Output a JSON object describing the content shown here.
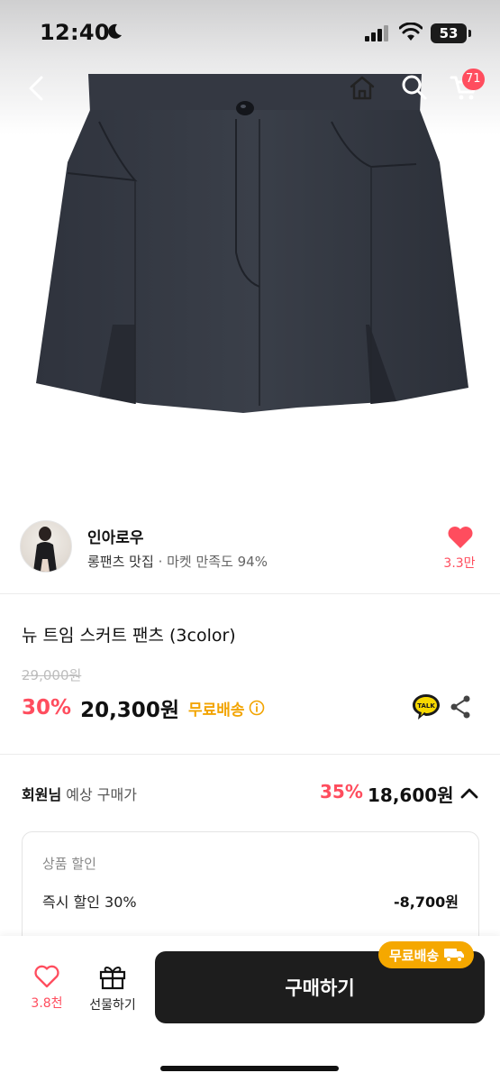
{
  "status_bar": {
    "time": "12:40",
    "battery": "53"
  },
  "nav": {
    "cart_count": "71"
  },
  "seller": {
    "name": "인아로우",
    "tagline": "롱팬츠 맛집",
    "satisfaction": "· 마켓 만족도 94%",
    "like_count": "3.3만"
  },
  "product": {
    "title": "뉴 트임 스커트 팬츠 (3color)",
    "original_price": "29,000원",
    "discount": "30%",
    "price": "20,300원",
    "shipping": "무료배송"
  },
  "member": {
    "label_strong": "회원님",
    "label_rest": " 예상 구매가",
    "discount": "35%",
    "price": "18,600원"
  },
  "discount_box": {
    "title": "상품 할인",
    "item_label": "즉시 할인 30%",
    "item_amount": "-8,700원"
  },
  "bottom_bar": {
    "like_count": "3.8천",
    "gift_label": "선물하기",
    "buy_label": "구매하기",
    "shipping_badge": "무료배송"
  },
  "colors": {
    "accent": "#ff4d5e",
    "shipping": "#f2a400",
    "buy_button": "#1d1d1d"
  },
  "icons": [
    "back-icon",
    "home-icon",
    "search-icon",
    "cart-icon",
    "heart-icon",
    "info-icon",
    "kakao-talk-icon",
    "share-icon",
    "chevron-up-icon",
    "gift-icon",
    "truck-icon"
  ]
}
